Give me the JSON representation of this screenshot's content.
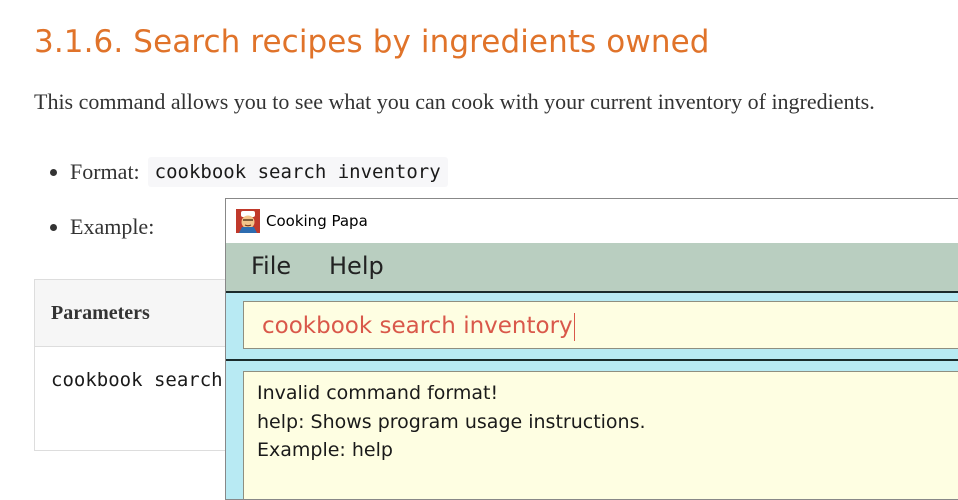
{
  "doc": {
    "title": "3.1.6. Search recipes by ingredients owned",
    "paragraph": "This command allows you to see what you can cook with your current inventory of ingredients.",
    "bullets": [
      {
        "label": "Format:",
        "code": "cookbook search inventory"
      },
      {
        "label": "Example:"
      }
    ],
    "table": {
      "header": "Parameters",
      "row_code": "cookbook search inventory"
    }
  },
  "window": {
    "title": "Cooking Papa",
    "icon": "cooking-papa-app-icon",
    "menu": [
      "File",
      "Help"
    ],
    "command_input": "cookbook search inventory",
    "result_lines": [
      "Invalid command format!",
      "help: Shows program usage instructions.",
      "Example: help"
    ]
  },
  "colors": {
    "heading": "#e0732a",
    "menubar": "#b9cec0",
    "panel": "#b8eaf3",
    "input_bg": "#fefee2",
    "input_text": "#d9584a"
  }
}
